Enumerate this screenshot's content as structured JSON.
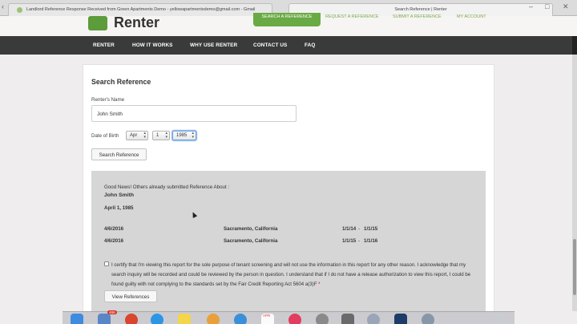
{
  "browser": {
    "tab1_title": "Landlord Reference Response Received from Green Apartments Demo - yellowapartmentsdemo@gmail.com - Gmail",
    "tab2_title": "Search Reference | Renter",
    "url_fragment": "renter.com"
  },
  "site": {
    "logo": "Renter",
    "top_links": [
      "SEARCH A REFERENCE",
      "REQUEST A REFERENCE",
      "SUBMIT A REFERENCE",
      "MY ACCOUNT"
    ]
  },
  "nav": {
    "items": [
      "RENTER",
      "HOW IT WORKS",
      "WHY USE RENTER",
      "CONTACT US",
      "FAQ"
    ]
  },
  "form": {
    "title": "Search Reference",
    "name_label": "Renter's Name",
    "name_value": "John Smith",
    "dob_label": "Date of Birth",
    "month": "Apr",
    "day": "1",
    "year": "1985",
    "search_button": "Search Reference"
  },
  "results": {
    "intro": "Good News! Others already submitted Reference About :",
    "name": "John Smith",
    "dob": "April 1, 1985",
    "rows": [
      {
        "date": "4/6/2016",
        "location": "Sacramento, California",
        "from": "1/1/14",
        "dash": "-",
        "to": "1/1/15"
      },
      {
        "date": "4/6/2016",
        "location": "Sacramento, California",
        "from": "1/1/15",
        "dash": "-",
        "to": "1/1/16"
      }
    ],
    "consent": "I certify that I'm viewing this report for the sole purpose of tenant screening and will not use the information in this report for any other reason. I acknowledge that my search inquiry will be recorded and could be reviewed by the person in question. I understand that if I do not have a release authorization to view this report, I could be found guilty with not complying to the standards set by the Fair Credit Reporting Act 5604 a(3)F",
    "required_mark": "*",
    "view_button": "View References"
  },
  "dock": {
    "mail_badge": "466",
    "calendar_label": "APR"
  },
  "colors": {
    "brand_green": "#6aaa44",
    "nav_bg": "#3a3a3a",
    "results_bg": "#d6d6d6"
  }
}
